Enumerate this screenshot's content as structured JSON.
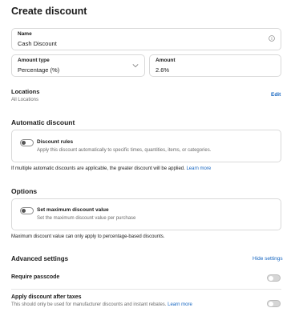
{
  "page": {
    "title": "Create discount"
  },
  "name_field": {
    "label": "Name",
    "value": "Cash Discount"
  },
  "amount_type": {
    "label": "Amount type",
    "value": "Percentage (%)"
  },
  "amount": {
    "label": "Amount",
    "value": "2.6%"
  },
  "locations": {
    "title": "Locations",
    "value": "All Locations",
    "edit_label": "Edit"
  },
  "automatic": {
    "title": "Automatic discount",
    "card_title": "Discount rules",
    "card_desc": "Apply this discount automatically to specific times, quantities, items, or categories.",
    "footnote": "If multiple automatic discounts are applicable, the greater discount will be applied.",
    "learn_more": "Learn more"
  },
  "options": {
    "title": "Options",
    "card_title": "Set maximum discount value",
    "card_desc": "Set the maximum discount value per purchase",
    "footnote": "Maximum discount value can only apply to percentage-based discounts."
  },
  "advanced": {
    "title": "Advanced settings",
    "hide_label": "Hide settings",
    "require_passcode": "Require passcode",
    "after_taxes": "Apply discount after taxes",
    "after_taxes_desc": "This should only be used for manufacturer discounts and instant rebates.",
    "learn_more": "Learn more"
  },
  "colors": {
    "accent": "#1565c0",
    "border": "#d9d9d9",
    "muted": "#6b6b6b"
  },
  "icons": {
    "info": "info-icon",
    "chevron": "chevron-down-icon"
  }
}
